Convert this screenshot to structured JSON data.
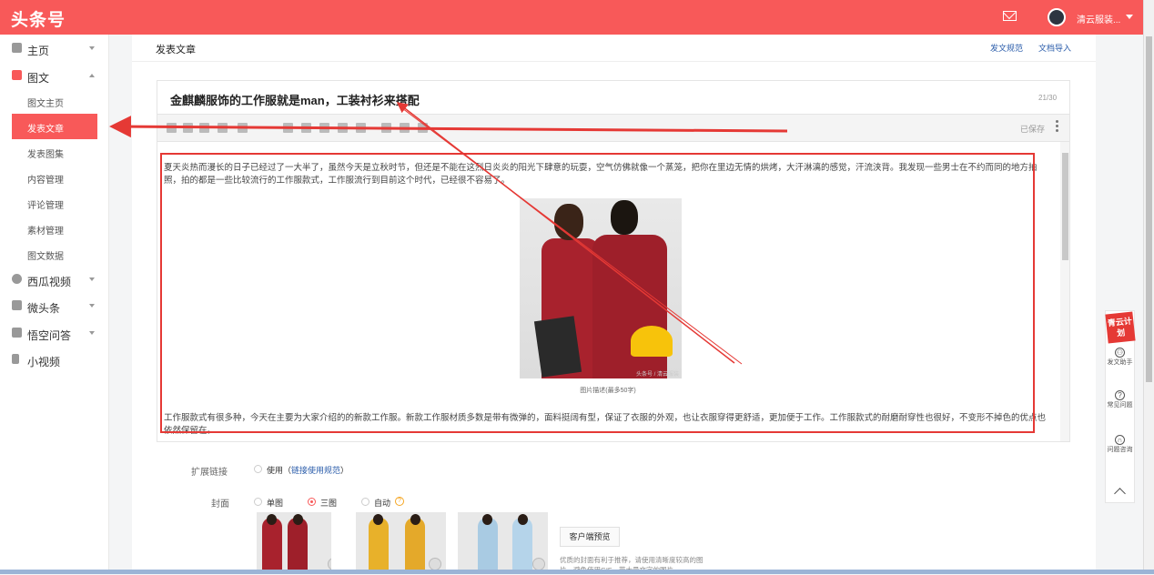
{
  "app": {
    "logo": "头条号"
  },
  "topbar": {
    "username": "清云服装...",
    "mail_icon": "mail-icon",
    "avatar_icon": "avatar"
  },
  "sidebar": {
    "items": [
      {
        "label": "主页",
        "icon": "home-icon",
        "expanded": false
      },
      {
        "label": "图文",
        "icon": "article-icon",
        "expanded": true,
        "children": [
          "图文主页",
          "发表文章",
          "发表图集",
          "内容管理",
          "评论管理",
          "素材管理",
          "图文数据"
        ],
        "active_child": "发表文章"
      },
      {
        "label": "西瓜视频",
        "icon": "video-icon",
        "expanded": false
      },
      {
        "label": "微头条",
        "icon": "micro-icon",
        "expanded": false
      },
      {
        "label": "悟空问答",
        "icon": "qa-icon",
        "expanded": false
      },
      {
        "label": "小视频",
        "icon": "short-video-icon",
        "expanded": false
      }
    ]
  },
  "main": {
    "title": "发表文章",
    "links": [
      "发文规范",
      "文档导入"
    ],
    "article": {
      "title": "金麒麟服饰的工作服就是man，工装衬衫来搭配",
      "title_count": "21/30",
      "saved_status": "已保存",
      "paragraph1": "夏天炎热而漫长的日子已经过了一大半了，虽然今天是立秋时节，但还是不能在这烈日炎炎的阳光下肆意的玩耍，空气仿佛就像一个蒸笼，把你在里边无情的烘烤，大汗淋漓的感觉，汗流浃背。我发现一些男士在不约而同的地方拍照，拍的都是一些比较流行的工作服款式，工作服流行到目前这个时代，已经很不容易了。",
      "image_watermark": "头条号 / 清云服装",
      "image_caption": "图片描述(最多50字)",
      "paragraph2": "工作服款式有很多种，今天在主要为大家介绍的的新款工作服。新款工作服材质多数是带有微弹的，面料挺阔有型，保证了衣服的外观，也让衣服穿得更舒适，更加便于工作。工作服款式的耐磨耐穿性也很好，不变形不掉色的优点也依然保留在。"
    },
    "extension": {
      "label": "扩展链接",
      "option": "使用",
      "link_open": "（",
      "link": "链接使用规范",
      "link_close": "）"
    },
    "cover": {
      "label": "封面",
      "options": [
        "单图",
        "三图",
        "自动"
      ],
      "selected": "三图",
      "preview_button": "客户端预览",
      "tip": "优质的封面有利于推荐，请使用清晰度较高的图片，避免使用GIF、带大量文字的图片。"
    },
    "colors": {
      "accent": "#f85959",
      "annotation": "#e53935",
      "link": "#2a5caa"
    }
  },
  "float_panel": {
    "logo": "青云计划",
    "items": [
      {
        "label": "发文助手",
        "icon": "assistant-icon"
      },
      {
        "label": "常见问题",
        "icon": "question-icon"
      },
      {
        "label": "问题咨询",
        "icon": "headset-icon"
      }
    ],
    "back_top_icon": "back-to-top-icon"
  }
}
